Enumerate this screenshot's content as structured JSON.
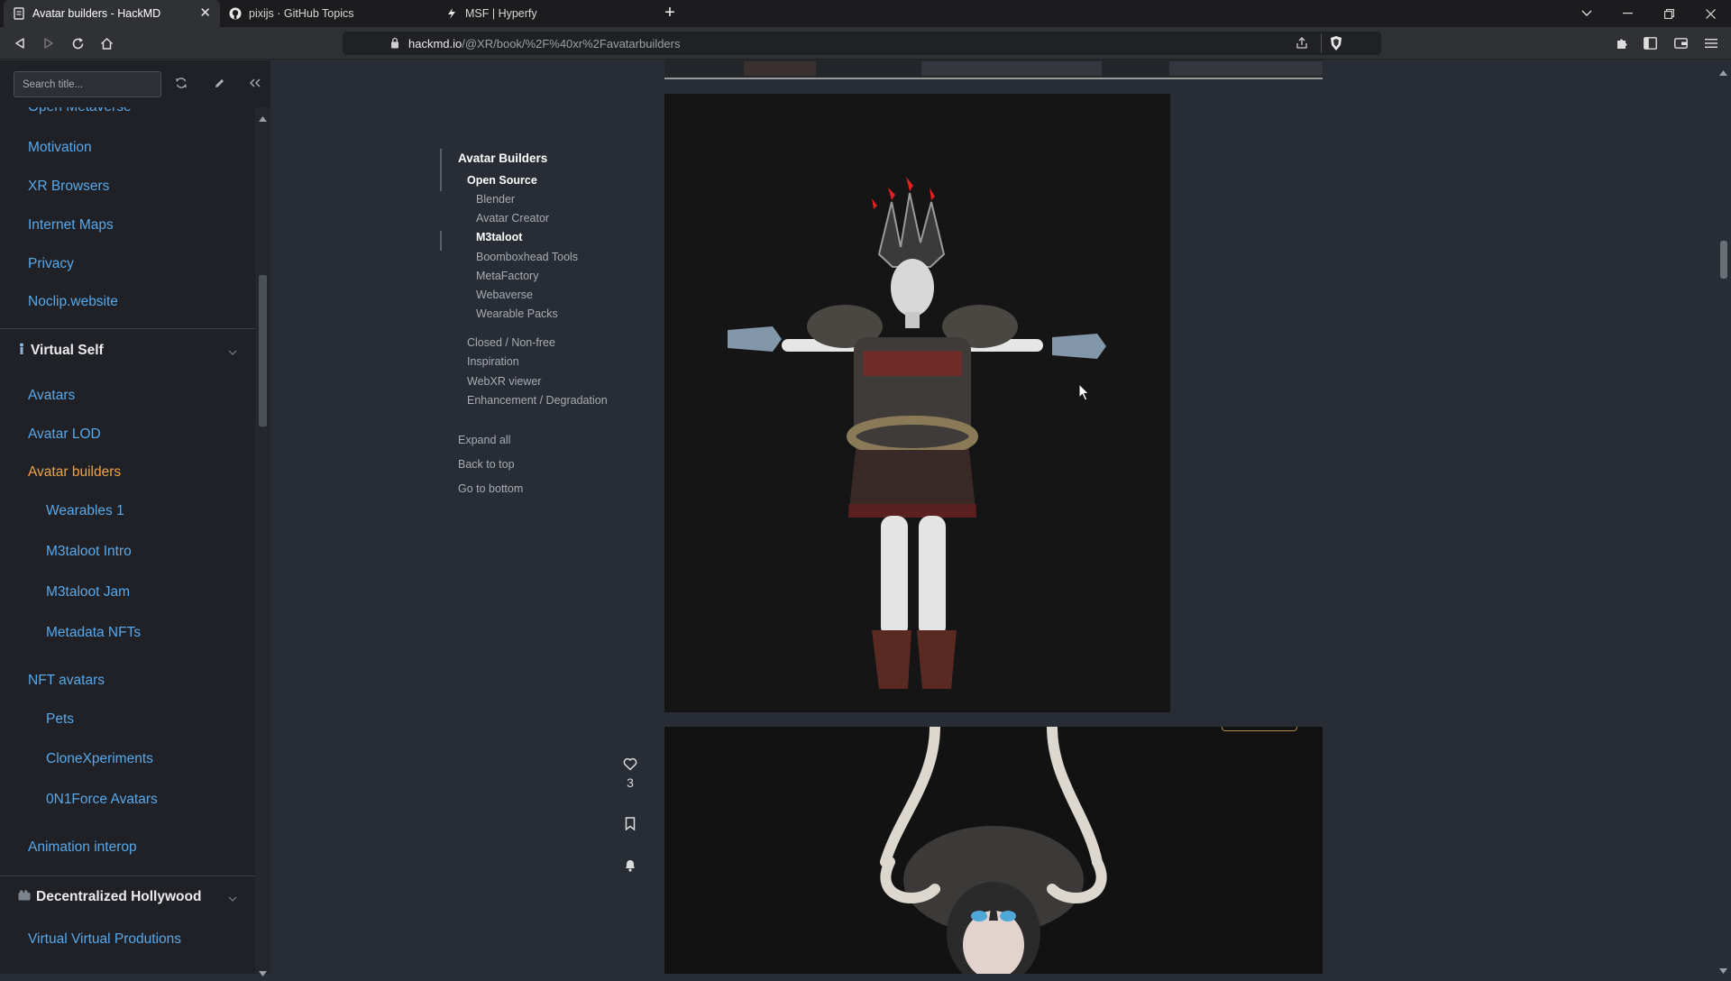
{
  "browser": {
    "tabs": [
      {
        "title": "Avatar builders - HackMD",
        "active": true
      },
      {
        "title": "pixijs · GitHub Topics",
        "active": false
      },
      {
        "title": "MSF | Hyperfy",
        "active": false
      }
    ],
    "url_domain": "hackmd.io",
    "url_path": "/@XR/book/%2F%40xr%2Favatarbuilders"
  },
  "sidebar": {
    "search_placeholder": "Search title...",
    "items": [
      {
        "label": "Open Metaverse",
        "level": 1
      },
      {
        "label": "Motivation",
        "level": 1
      },
      {
        "label": "XR Browsers",
        "level": 1
      },
      {
        "label": "Internet Maps",
        "level": 1
      },
      {
        "label": "Privacy",
        "level": 1
      },
      {
        "label": "Noclip.website",
        "level": 1
      }
    ],
    "section_virtual_self": "Virtual Self",
    "virtual_self_items": [
      {
        "label": "Avatars",
        "level": 1
      },
      {
        "label": "Avatar LOD",
        "level": 1
      },
      {
        "label": "Avatar builders",
        "level": 1,
        "active": true
      },
      {
        "label": "Wearables 1",
        "level": 2
      },
      {
        "label": "M3taloot Intro",
        "level": 2
      },
      {
        "label": "M3taloot Jam",
        "level": 2
      },
      {
        "label": "Metadata NFTs",
        "level": 2
      },
      {
        "label": "NFT avatars",
        "level": 1
      },
      {
        "label": "Pets",
        "level": 2
      },
      {
        "label": "CloneXperiments",
        "level": 2
      },
      {
        "label": "0N1Force Avatars",
        "level": 2
      },
      {
        "label": "Animation interop",
        "level": 1
      }
    ],
    "section_hollywood": "Decentralized Hollywood",
    "hollywood_items": [
      {
        "label": "Virtual Virtual Produtions",
        "level": 1
      }
    ]
  },
  "toc": {
    "title": "Avatar Builders",
    "open_source": "Open Source",
    "open_source_items": [
      "Blender",
      "Avatar Creator",
      "M3taloot",
      "Boomboxhead Tools",
      "MetaFactory",
      "Webaverse",
      "Wearable Packs"
    ],
    "other_items": [
      "Closed / Non-free",
      "Inspiration",
      "WebXR viewer",
      "Enhancement / Degradation"
    ],
    "controls": [
      "Expand all",
      "Back to top",
      "Go to bottom"
    ]
  },
  "actions": {
    "like_count": "3"
  },
  "colors": {
    "link": "#59a8ea",
    "active_link": "#f0a346",
    "sidebar_bg": "#1f2126",
    "content_bg": "#282c34"
  }
}
